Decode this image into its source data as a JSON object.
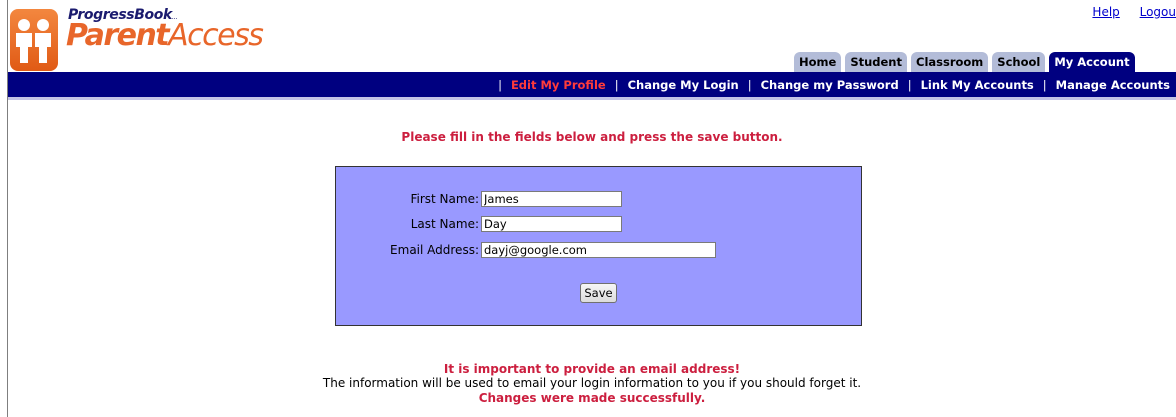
{
  "header": {
    "brand_top": "ProgressBook",
    "brand_top_mark": "...",
    "brand_main_bold": "Parent",
    "brand_main_rest": "Access",
    "logo_icon": "parent-child-icon",
    "links": {
      "help": "Help",
      "logout": "Logou"
    }
  },
  "tabs": [
    {
      "label": "Home",
      "active": false
    },
    {
      "label": "Student",
      "active": false
    },
    {
      "label": "Classroom",
      "active": false
    },
    {
      "label": "School",
      "active": false
    },
    {
      "label": "My Account",
      "active": true
    }
  ],
  "subnav": {
    "items": [
      "Edit My Profile",
      "Change My Login",
      "Change my Password",
      "Link My Accounts",
      "Manage Accounts"
    ],
    "current": "Edit My Profile",
    "separator": "|"
  },
  "main": {
    "instruction": "Please fill in the fields below and press the save button.",
    "form": {
      "first_name_label": "First Name:",
      "first_name_value": "James",
      "last_name_label": "Last Name:",
      "last_name_value": "Day",
      "email_label": "Email Address:",
      "email_value": "dayj@google.com",
      "save_label": "Save"
    },
    "email_notice": "It is important to provide an email address!",
    "email_info": "The information will be used to email your login information to you if you should forget it.",
    "status": "Changes were made successfully."
  },
  "colors": {
    "nav_bg": "#000080",
    "tab_bg": "#b3bcd8",
    "form_bg": "#9999ff",
    "alert_red": "#cc1f3f",
    "brand_orange": "#e8662a"
  }
}
